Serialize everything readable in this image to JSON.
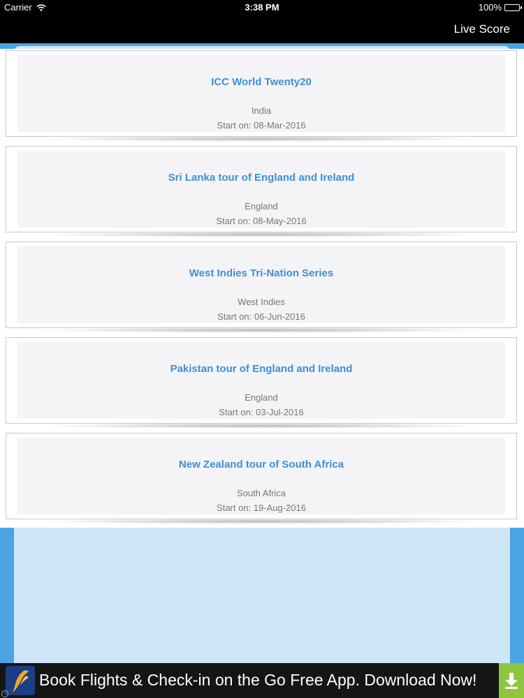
{
  "status_bar": {
    "carrier": "Carrier",
    "time": "3:38 PM",
    "battery": "100%"
  },
  "nav": {
    "action_label": "Live Score"
  },
  "series": [
    {
      "title": "ICC World Twenty20",
      "country": "India",
      "start": "Start on: 08-Mar-2016"
    },
    {
      "title": "Sri Lanka tour of England and Ireland",
      "country": "England",
      "start": "Start on: 08-May-2016"
    },
    {
      "title": "West Indies Tri-Nation Series",
      "country": "West Indies",
      "start": "Start on: 06-Jun-2016"
    },
    {
      "title": "Pakistan tour of England and Ireland",
      "country": "England",
      "start": "Start on: 03-Jul-2016"
    },
    {
      "title": "New Zealand tour of South Africa",
      "country": "South Africa",
      "start": "Start on: 19-Aug-2016"
    }
  ],
  "ad": {
    "text": "Book Flights & Check-in on the Go Free App. Download Now!",
    "logo_icon": "airline-logo-icon",
    "download_icon": "download-arrow-icon",
    "info_icon": "info-icon"
  },
  "colors": {
    "background_blue": "#4aa3e3",
    "title_blue": "#3e8fd6",
    "ad_green": "#8ec63f"
  }
}
